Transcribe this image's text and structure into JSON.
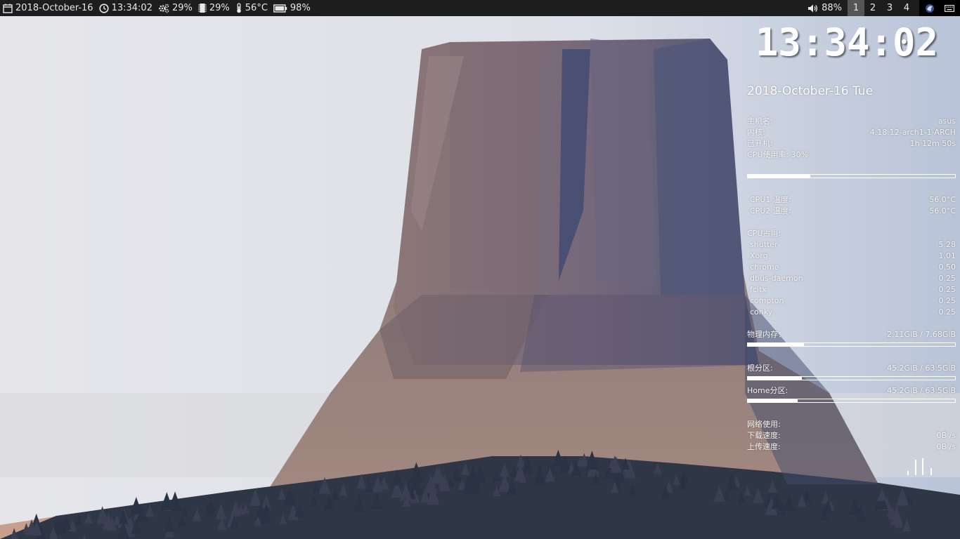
{
  "topbar": {
    "date": "2018-October-16",
    "time": "13:34:02",
    "cpu": "29%",
    "mem": "29%",
    "temp": "56°C",
    "battery": "98%",
    "volume": "88%",
    "workspaces": [
      "1",
      "2",
      "3",
      "4"
    ],
    "active_workspace": "1"
  },
  "conky": {
    "clock": "13:34:02",
    "date": "2018-October-16 Tue",
    "hostname_label": "主机名:",
    "hostname": "asus",
    "kernel_label": "内核:",
    "kernel": "4.18.12-arch1-1-ARCH",
    "uptime_label": "已开机:",
    "uptime": "1h 12m 50s",
    "cpu_label": "CPU使用率: 30%",
    "cpu_usage": 30,
    "cpu1_label": "CPU1 温度:",
    "cpu1_temp": "56.0°C",
    "cpu2_label": "CPU2 温度:",
    "cpu2_temp": "56.0°C",
    "proc_header": "CPU占用:",
    "processes": [
      {
        "name": "shutter",
        "value": "5.28"
      },
      {
        "name": "Xorg",
        "value": "1.01"
      },
      {
        "name": "chrome",
        "value": "0.50"
      },
      {
        "name": "dbus-daemon",
        "value": "0.25"
      },
      {
        "name": "fcitx",
        "value": "0.25"
      },
      {
        "name": "compton",
        "value": "0.25"
      },
      {
        "name": "conky",
        "value": "0.25"
      }
    ],
    "mem_label": "物理内存：",
    "mem_value": "2.11GiB / 7.68GiB",
    "mem_usage": 27,
    "root_label": "根分区:",
    "root_value": "45.2GiB / 63.5GiB",
    "root_usage": 26,
    "home_label": "Home分区:",
    "home_value": "45.2GiB / 63.5GiB",
    "home_usage": 24,
    "net_label": "网络使用:",
    "down_label": "下载速度:",
    "down_value": "0B  /s",
    "up_label": "上传速度:",
    "up_value": "0B  /s"
  },
  "colors": {
    "topbar_bg": "#1d1d1d",
    "active_workspace_bg": "#555555",
    "text": "#ffffff"
  }
}
